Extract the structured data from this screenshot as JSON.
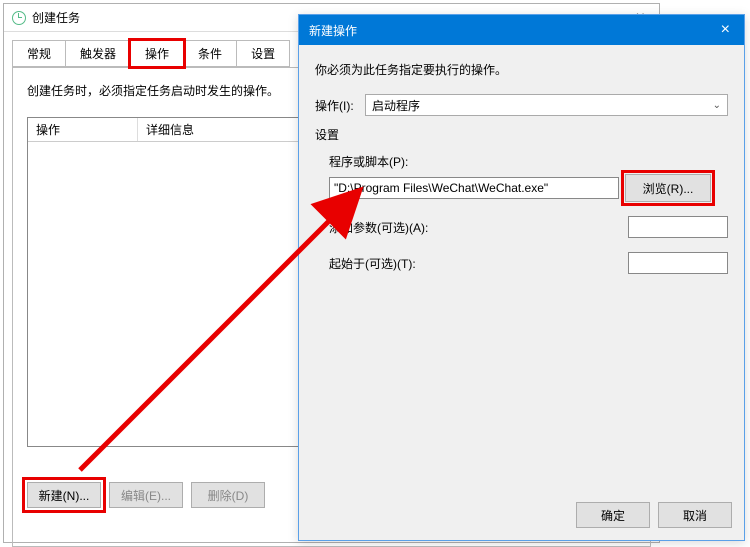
{
  "create_dialog": {
    "title": "创建任务",
    "tabs": {
      "general": "常规",
      "triggers": "触发器",
      "actions": "操作",
      "conditions": "条件",
      "settings": "设置"
    },
    "desc": "创建任务时，必须指定任务启动时发生的操作。",
    "columns": {
      "action": "操作",
      "detail": "详细信息"
    },
    "buttons": {
      "new": "新建(N)...",
      "edit": "编辑(E)...",
      "delete": "删除(D)"
    }
  },
  "action_dialog": {
    "title": "新建操作",
    "instruction": "你必须为此任务指定要执行的操作。",
    "op_label": "操作(I):",
    "op_value": "启动程序",
    "settings_label": "设置",
    "program_label": "程序或脚本(P):",
    "program_value": "\"D:\\Program Files\\WeChat\\WeChat.exe\"",
    "browse": "浏览(R)...",
    "args_label": "添加参数(可选)(A):",
    "args_value": "",
    "startin_label": "起始于(可选)(T):",
    "startin_value": "",
    "ok": "确定",
    "cancel": "取消"
  }
}
